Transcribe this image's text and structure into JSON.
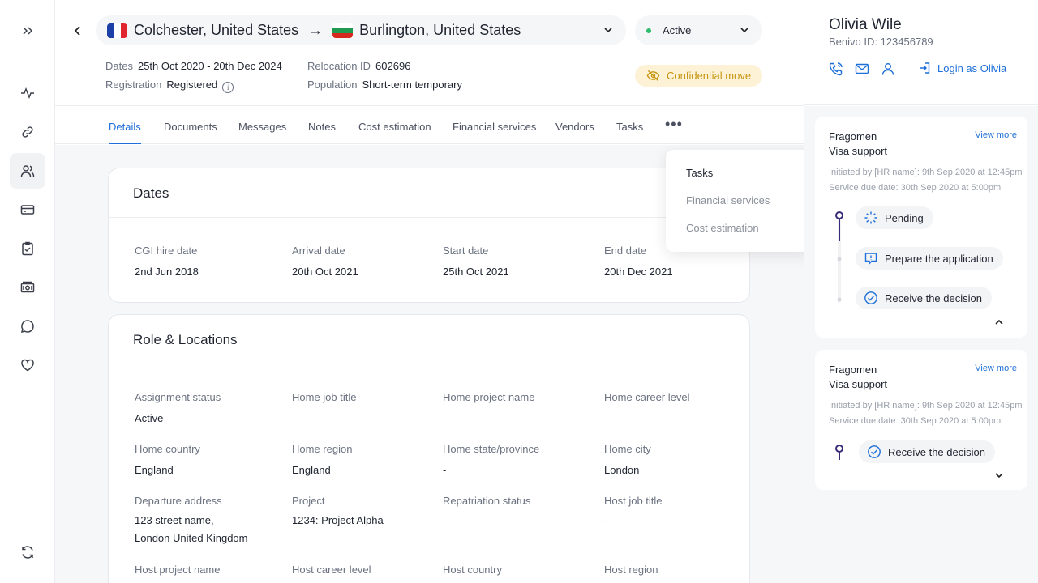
{
  "header": {
    "from_city": "Colchester, United States",
    "to_city": "Burlington, United States",
    "arrow": "→",
    "status": "Active",
    "dates_label": "Dates",
    "dates_value": "25th Oct 2020 - 20th Dec 2024",
    "registration_label": "Registration",
    "registration_value": "Registered",
    "relocation_label": "Relocation ID",
    "relocation_value": "602696",
    "population_label": "Population",
    "population_value": "Short-term temporary",
    "confidential": "Confidential move"
  },
  "tabs": [
    "Details",
    "Documents",
    "Messages",
    "Notes",
    "Cost estimation",
    "Financial services",
    "Vendors",
    "Tasks"
  ],
  "tabs_more": "•••",
  "dropdown": [
    "Tasks",
    "Financial services",
    "Cost estimation"
  ],
  "dates_card": {
    "title": "Dates",
    "fields": [
      {
        "label": "CGI hire date",
        "value": "2nd Jun 2018"
      },
      {
        "label": "Arrival date",
        "value": "20th Oct 2021"
      },
      {
        "label": "Start date",
        "value": "25th Oct 2021"
      },
      {
        "label": "End date",
        "value": "20th Dec 2021"
      }
    ]
  },
  "role_card": {
    "title": "Role & Locations",
    "fields": [
      {
        "label": "Assignment status",
        "value": "Active"
      },
      {
        "label": "Home job title",
        "value": "-"
      },
      {
        "label": "Home project name",
        "value": "-"
      },
      {
        "label": "Home career level",
        "value": "-"
      },
      {
        "label": "Home country",
        "value": "England"
      },
      {
        "label": "Home region",
        "value": "England"
      },
      {
        "label": "Home state/province",
        "value": "-"
      },
      {
        "label": "Home city",
        "value": "London"
      },
      {
        "label": "Departure address",
        "value": "123 street name,",
        "value2": "London United Kingdom"
      },
      {
        "label": "Project",
        "value": "1234: Project Alpha"
      },
      {
        "label": "Repatriation status",
        "value": "-"
      },
      {
        "label": "Host job title",
        "value": "-"
      },
      {
        "label": "Host project name",
        "value": ""
      },
      {
        "label": "Host career level",
        "value": ""
      },
      {
        "label": "Host country",
        "value": ""
      },
      {
        "label": "Host region",
        "value": ""
      }
    ]
  },
  "user": {
    "name": "Olivia Wile",
    "id": "Benivo ID: 123456789",
    "login": "Login as Olivia"
  },
  "services": [
    {
      "vendor": "Fragomen",
      "service": "Visa support",
      "view_more": "View more",
      "initiated": "Initiated by [HR name]: 9th Sep 2020 at 12:45pm",
      "due": "Service due date: 30th Sep 2020 at 5:00pm",
      "steps": [
        "Pending",
        "Prepare the application",
        "Receive the decision"
      ]
    },
    {
      "vendor": "Fragomen",
      "service": "Visa support",
      "view_more": "View more",
      "initiated": "Initiated by [HR name]: 9th Sep 2020 at 12:45pm",
      "due": "Service due date: 30th Sep 2020 at 5:00pm",
      "steps": [
        "Receive the decision"
      ]
    }
  ],
  "colors": {
    "accent": "#1e6fd9",
    "status_dot": "#2dbe6c",
    "confidential_bg": "#fdf2d6",
    "confidential_text": "#c79712",
    "timeline": "#3b2a7a"
  }
}
